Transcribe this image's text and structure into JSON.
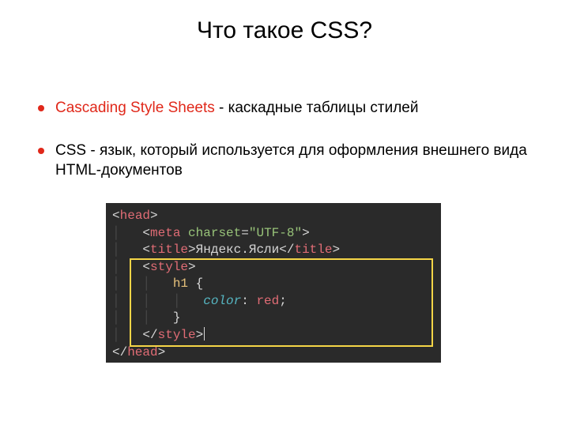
{
  "title": "Что такое CSS?",
  "bullets": [
    {
      "term": "Cascading Style Sheets",
      "rest": " - каскадные таблицы стилей"
    },
    {
      "term": "",
      "rest": "CSS - язык, который используется для оформления внешнего вида HTML-документов"
    }
  ],
  "code": {
    "head_open": "head",
    "meta": {
      "tag": "meta",
      "attr": "charset",
      "val": "\"UTF-8\""
    },
    "title": {
      "tag": "title",
      "text": "Яндекс.Ясли"
    },
    "style_open": "style",
    "rule": {
      "selector": "h1",
      "prop": "color",
      "val": "red"
    },
    "style_close": "style",
    "head_close": "head"
  }
}
